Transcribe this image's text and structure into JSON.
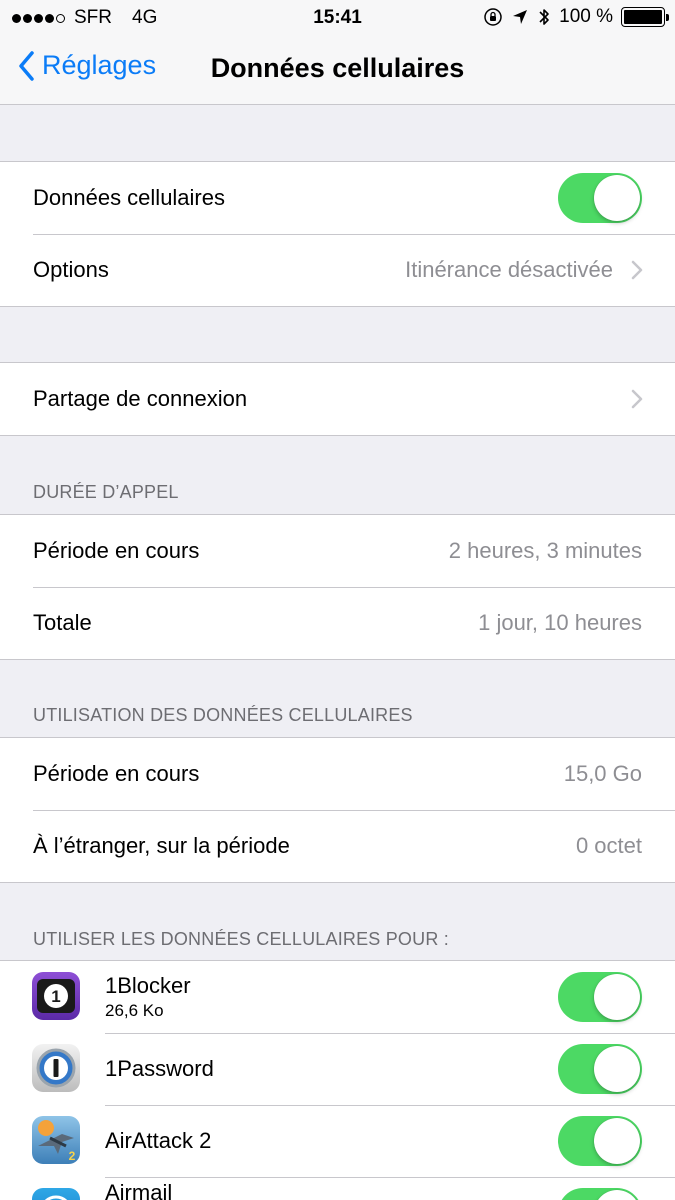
{
  "status_bar": {
    "carrier": "SFR",
    "network": "4G",
    "time": "15:41",
    "battery": "100 %",
    "battery_level": 1.0,
    "signal_bars": 4,
    "signal_max": 5
  },
  "nav": {
    "back_label": "Réglages",
    "title": "Données cellulaires"
  },
  "colors": {
    "accent": "#0b7cf7",
    "toggle_on": "#4cd964",
    "background": "#efeff4",
    "secondary_text": "#8e8e93"
  },
  "cellular": {
    "toggle_label": "Données cellulaires",
    "toggle_on": true,
    "options_label": "Options",
    "options_value": "Itinérance désactivée"
  },
  "hotspot": {
    "label": "Partage de connexion"
  },
  "call_time": {
    "header": "DURÉE D’APPEL",
    "rows": [
      {
        "label": "Période en cours",
        "value": "2 heures, 3 minutes"
      },
      {
        "label": "Totale",
        "value": "1 jour, 10 heures"
      }
    ]
  },
  "data_usage": {
    "header": "UTILISATION DES DONNÉES CELLULAIRES",
    "rows": [
      {
        "label": "Période en cours",
        "value": "15,0 Go"
      },
      {
        "label": "À l’étranger, sur la période",
        "value": "0 octet"
      }
    ]
  },
  "apps": {
    "header": "UTILISER LES DONNÉES CELLULAIRES POUR :",
    "items": [
      {
        "name": "1Blocker",
        "usage": "26,6 Ko",
        "enabled": true,
        "icon": "1blocker-icon"
      },
      {
        "name": "1Password",
        "usage": "",
        "enabled": true,
        "icon": "1password-icon"
      },
      {
        "name": "AirAttack 2",
        "usage": "",
        "enabled": true,
        "icon": "airattack-icon"
      },
      {
        "name": "Airmail",
        "usage": "",
        "enabled": true,
        "icon": "airmail-icon"
      }
    ]
  }
}
